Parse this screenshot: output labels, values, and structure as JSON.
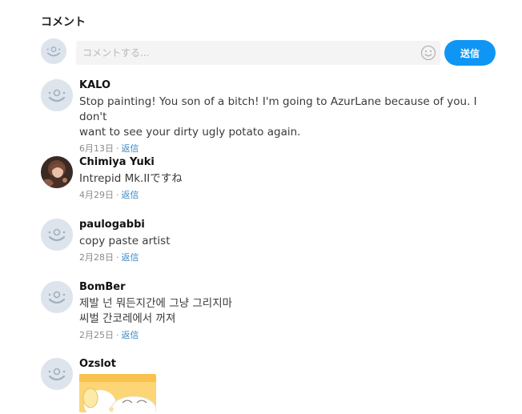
{
  "section": {
    "title": "コメント"
  },
  "composer": {
    "placeholder": "コメントする...",
    "send_label": "送信"
  },
  "comments": [
    {
      "user": "KALO",
      "avatar": "default-avatar-icon",
      "lines": [
        "Stop painting! You son of a bitch! I'm going to AzurLane because of you. I don't",
        "want to see your dirty ugly potato again."
      ],
      "date": "6月13日",
      "reply": "返信"
    },
    {
      "user": "Chimiya Yuki",
      "avatar": "user-photo-avatar",
      "lines": [
        "Intrepid Mk.IIですね"
      ],
      "date": "4月29日",
      "reply": "返信"
    },
    {
      "user": "paulogabbi",
      "avatar": "default-avatar-icon",
      "lines": [
        "copy paste artist"
      ],
      "date": "2月28日",
      "reply": "返信"
    },
    {
      "user": "BomBer",
      "avatar": "default-avatar-icon",
      "lines": [
        "제발 넌 뭐든지간에 그냥 그리지마",
        "씨벌 간코레에서 꺼져"
      ],
      "date": "2月25日",
      "reply": "返信"
    },
    {
      "user": "Ozslot",
      "avatar": "default-avatar-icon",
      "lines": [],
      "date": "",
      "reply": "",
      "image": "illustration-thumbnail"
    }
  ],
  "colors": {
    "accent": "#0f96f4",
    "reply_link": "#3a88c8",
    "avatar_bg": "#dde4ec"
  }
}
